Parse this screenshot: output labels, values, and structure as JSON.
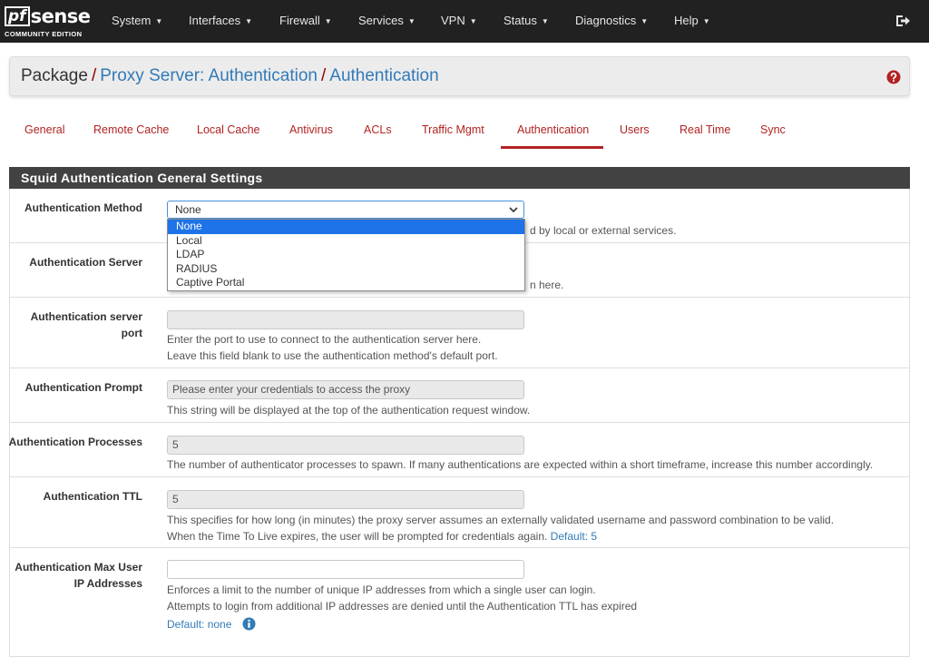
{
  "logo": {
    "pf": "pf",
    "sense": "sense",
    "subtitle": "COMMUNITY EDITION"
  },
  "nav": {
    "items": [
      {
        "label": "System"
      },
      {
        "label": "Interfaces"
      },
      {
        "label": "Firewall"
      },
      {
        "label": "Services"
      },
      {
        "label": "VPN"
      },
      {
        "label": "Status"
      },
      {
        "label": "Diagnostics"
      },
      {
        "label": "Help"
      }
    ],
    "logout_icon": "logout-icon"
  },
  "breadcrumb": {
    "root": "Package",
    "sep": "/",
    "link1": "Proxy Server: Authentication",
    "link2": "Authentication",
    "help_icon": "question-circle-icon"
  },
  "tabs": {
    "active": "Authentication",
    "items": [
      {
        "label": "General"
      },
      {
        "label": "Remote Cache"
      },
      {
        "label": "Local Cache"
      },
      {
        "label": "Antivirus"
      },
      {
        "label": "ACLs"
      },
      {
        "label": "Traffic Mgmt"
      },
      {
        "label": "Authentication"
      },
      {
        "label": "Users"
      },
      {
        "label": "Real Time"
      },
      {
        "label": "Sync"
      }
    ]
  },
  "panel": {
    "title": "Squid Authentication General Settings"
  },
  "fields": {
    "method": {
      "label": "Authentication Method",
      "value": "None",
      "help_visible": "d by local or external services.",
      "options": [
        "None",
        "Local",
        "LDAP",
        "RADIUS",
        "Captive Portal"
      ],
      "selected_index": 0
    },
    "server": {
      "label": "Authentication Server",
      "help_visible": "n here."
    },
    "port": {
      "label_line1": "Authentication server",
      "label_line2": "port",
      "value": "",
      "help1": "Enter the port to use to connect to the authentication server here.",
      "help2": "Leave this field blank to use the authentication method's default port."
    },
    "prompt": {
      "label": "Authentication Prompt",
      "value": "Please enter your credentials to access the proxy",
      "help": "This string will be displayed at the top of the authentication request window."
    },
    "processes": {
      "label": "Authentication Processes",
      "value": "5",
      "help": "The number of authenticator processes to spawn. If many authentications are expected within a short timeframe, increase this number accordingly."
    },
    "ttl": {
      "label": "Authentication TTL",
      "value": "5",
      "help1": "This specifies for how long (in minutes) the proxy server assumes an externally validated username and password combination to be valid.",
      "help2": "When the Time To Live expires, the user will be prompted for credentials again.",
      "default": "Default: 5"
    },
    "max_ip": {
      "label_line1": "Authentication Max User",
      "label_line2": "IP Addresses",
      "value": "",
      "help1": "Enforces a limit to the number of unique IP addresses from which a single user can login.",
      "help2": "Attempts to login from additional IP addresses are denied until the Authentication TTL has expired",
      "default": "Default: none",
      "info_icon": "info-circle-icon"
    }
  },
  "colors": {
    "navbar": "#212121",
    "panel_heading": "#424242",
    "accent_red": "#b22222",
    "link_blue": "#337ab7",
    "selected_option": "#1e73e8"
  }
}
